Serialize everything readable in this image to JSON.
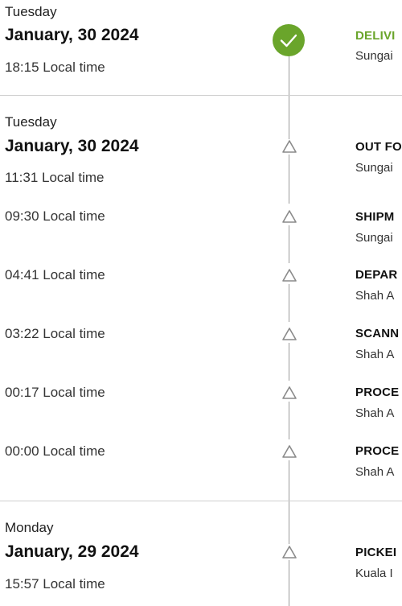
{
  "groups": [
    {
      "day": "Tuesday",
      "date": "January, 30 2024",
      "events": [
        {
          "time": "18:15 Local time",
          "status": "DELIVI",
          "location": "Sungai",
          "delivered": true,
          "icon": "check-icon"
        }
      ]
    },
    {
      "day": "Tuesday",
      "date": "January, 30 2024",
      "events": [
        {
          "time": "11:31 Local time",
          "status": "OUT FO",
          "location": "Sungai",
          "icon": "triangle-icon"
        },
        {
          "time": "09:30 Local time",
          "status": "SHIPM",
          "location": "Sungai",
          "icon": "triangle-icon"
        },
        {
          "time": "04:41 Local time",
          "status": "DEPAR",
          "location": "Shah A",
          "icon": "triangle-icon"
        },
        {
          "time": "03:22 Local time",
          "status": "SCANN",
          "location": "Shah A",
          "icon": "triangle-icon"
        },
        {
          "time": "00:17 Local time",
          "status": "PROCE",
          "location": "Shah A",
          "icon": "triangle-icon"
        },
        {
          "time": "00:00 Local time",
          "status": "PROCE",
          "location": "Shah A",
          "icon": "triangle-icon"
        }
      ]
    },
    {
      "day": "Monday",
      "date": "January, 29 2024",
      "events": [
        {
          "time": "15:57 Local time",
          "status": "PICKEI",
          "location": "Kuala I",
          "icon": "triangle-icon"
        }
      ]
    }
  ],
  "colors": {
    "delivered": "#6aa52b",
    "timeline": "#9a9a9a",
    "divider": "#cfcfcf"
  }
}
